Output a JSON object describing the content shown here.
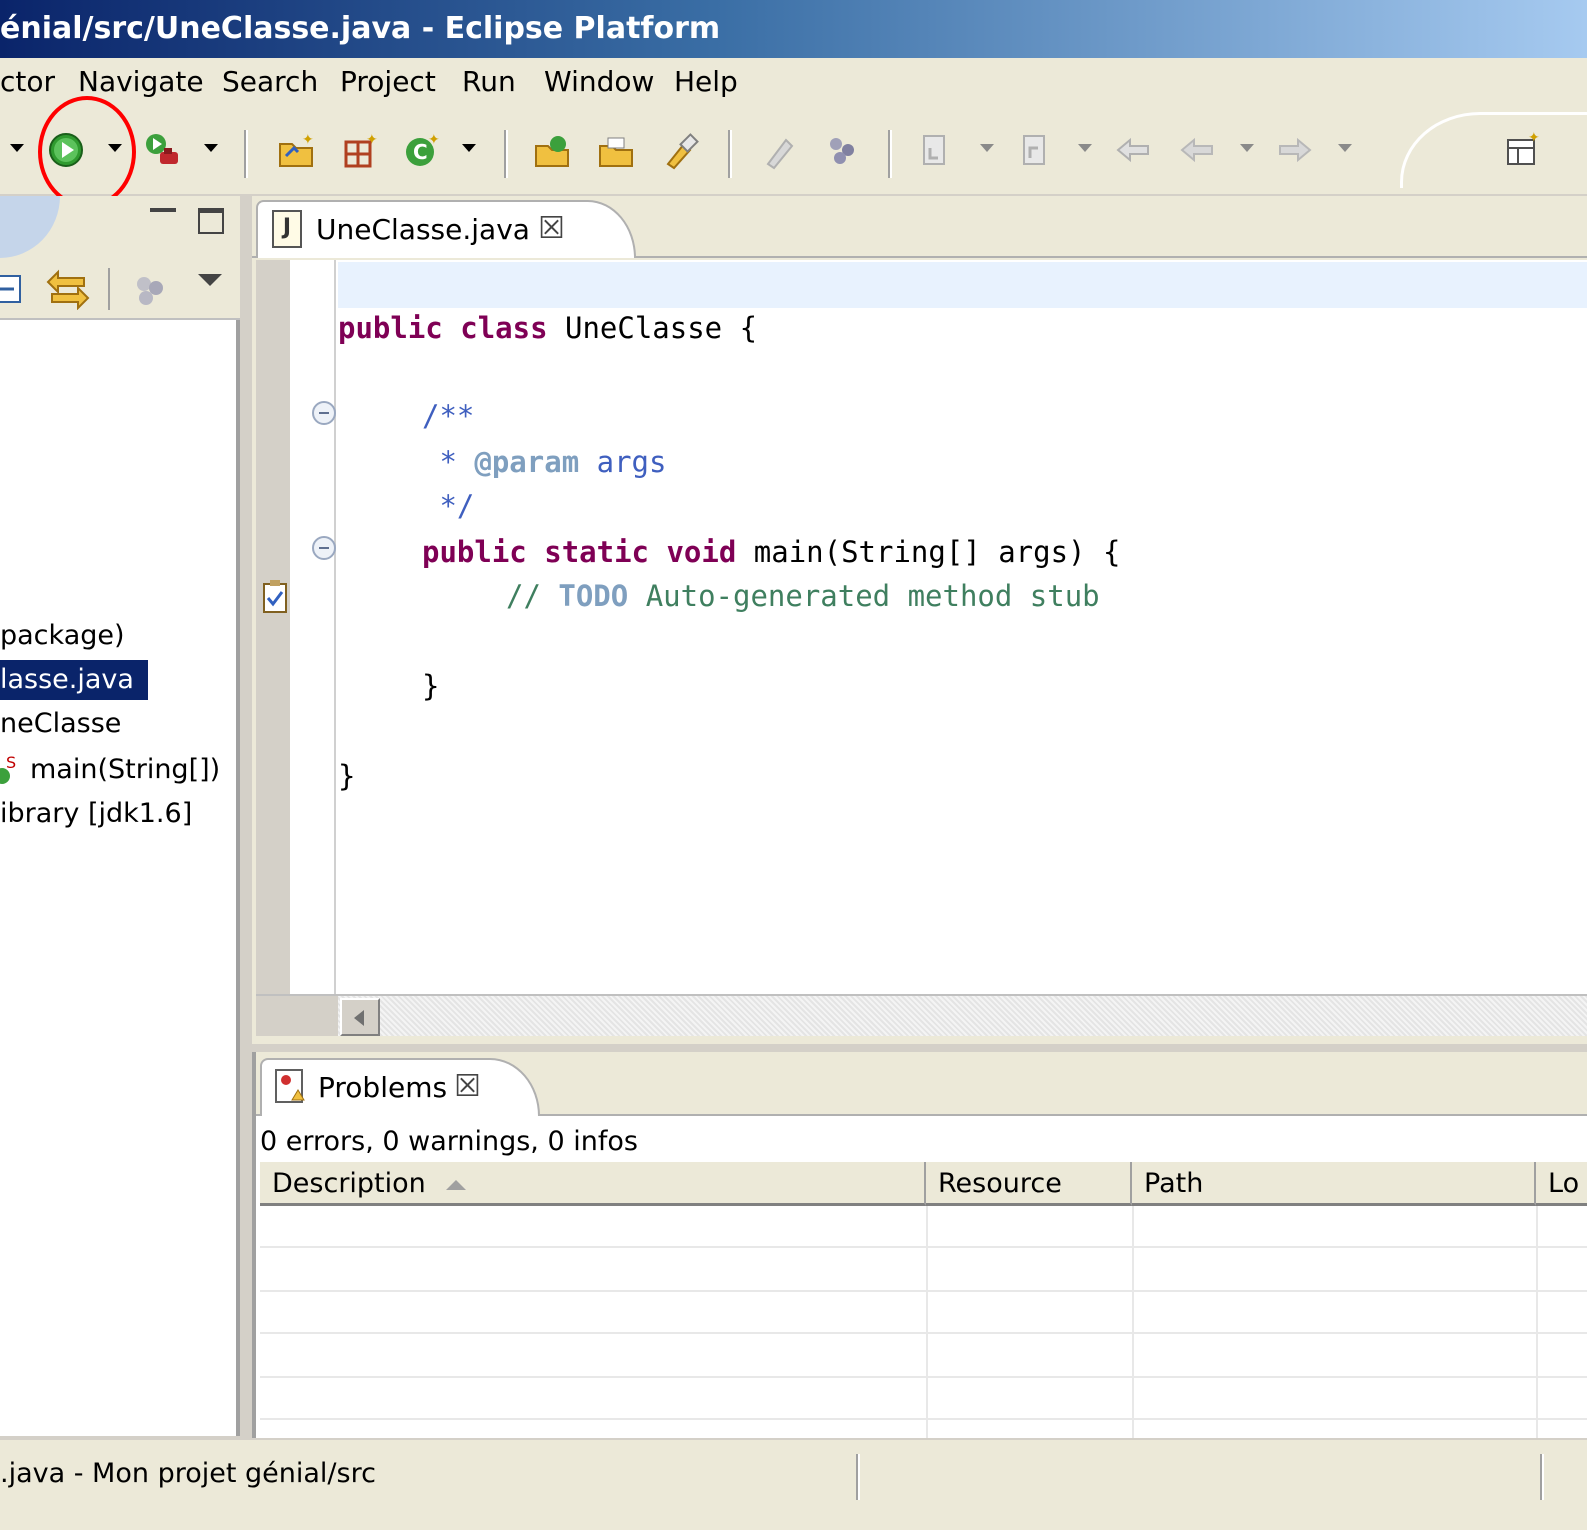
{
  "window": {
    "title": "énial/src/UneClasse.java - Eclipse Platform"
  },
  "menu": {
    "items": [
      "ctor",
      "Navigate",
      "Search",
      "Project",
      "Run",
      "Window",
      "Help"
    ]
  },
  "toolbar": {
    "buttons": [
      "run",
      "external-tools",
      "new-java-project",
      "new-package",
      "new-class",
      "open-type",
      "open-task",
      "search",
      "toggle-mark",
      "next-annotation",
      "previous-annotation",
      "last-edit",
      "back",
      "forward",
      "open-perspective"
    ],
    "highlight_color": "#ff0000"
  },
  "package_explorer": {
    "items": [
      "package)",
      "lasse.java",
      "neClasse",
      "main(String[])",
      "ibrary [jdk1.6]"
    ],
    "selected": "lasse.java"
  },
  "editor": {
    "tab_label": "UneClasse.java",
    "tab_icon_text": "J",
    "close_glyph": "☒",
    "code": {
      "kw_public": "public",
      "kw_class": "class",
      "class_decl_rest": " UneClasse {",
      "javadoc_open": "/**",
      "javadoc_star": " * ",
      "javadoc_tag": "@param",
      "javadoc_arg": " args",
      "javadoc_close": " */",
      "kw_static": "static",
      "kw_void": "void",
      "method_rest": " main(String[] args) {",
      "comment_slashes": "// ",
      "comment_todo": "TODO",
      "comment_rest": " Auto-generated method stub",
      "method_close": "}",
      "class_close": "}"
    }
  },
  "problems": {
    "tab_label": "Problems",
    "summary": "0 errors, 0 warnings, 0 infos",
    "columns": [
      "Description",
      "Resource",
      "Path",
      "Lo"
    ]
  },
  "statusbar": {
    "text": ".java - Mon projet génial/src"
  }
}
